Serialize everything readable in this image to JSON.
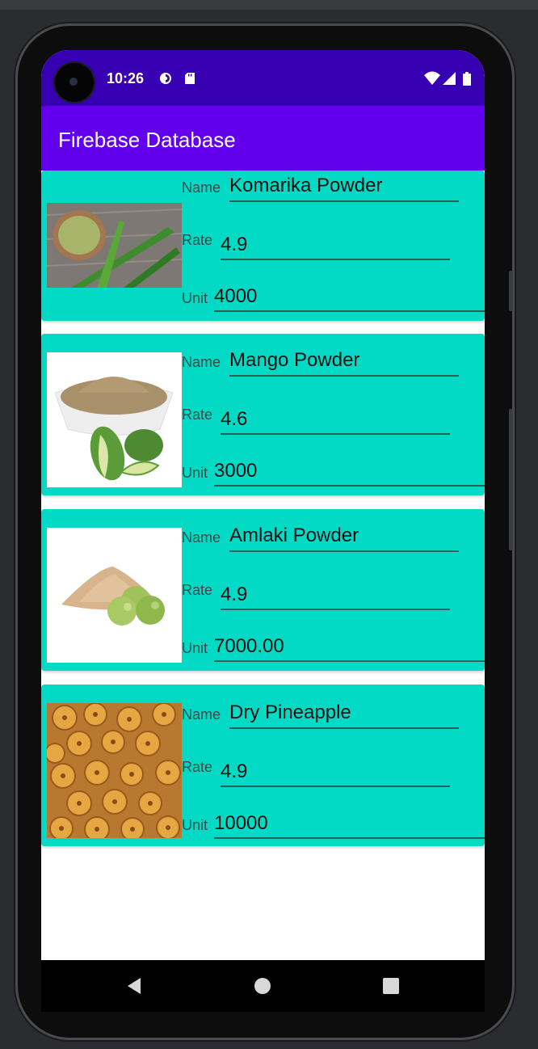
{
  "status_bar": {
    "time": "10:26",
    "icons": [
      "sync-icon",
      "sd-card-icon",
      "wifi-icon",
      "signal-icon",
      "battery-icon"
    ]
  },
  "app_bar": {
    "title": "Firebase Database"
  },
  "field_labels": {
    "name": "Name",
    "rate": "Rate",
    "unit": "Unit"
  },
  "items": [
    {
      "name": "Komarika Powder",
      "rate": "4.9",
      "unit": "4000",
      "image": "komarika-powder-image"
    },
    {
      "name": "Mango Powder",
      "rate": "4.6",
      "unit": "3000",
      "image": "mango-powder-image"
    },
    {
      "name": "Amlaki Powder",
      "rate": "4.9",
      "unit": "7000.00",
      "image": "amlaki-powder-image"
    },
    {
      "name": "Dry Pineapple",
      "rate": "4.9",
      "unit": "10000",
      "image": "dry-pineapple-image"
    }
  ],
  "nav_bar": {
    "buttons": [
      "back-icon",
      "home-icon",
      "recents-icon"
    ]
  },
  "colors": {
    "status_bar": "#3700b3",
    "app_bar": "#6200ee",
    "card": "#03dac5",
    "background": "#ffffff"
  }
}
